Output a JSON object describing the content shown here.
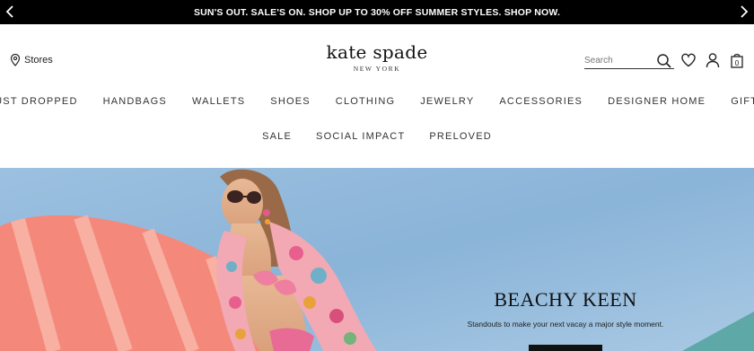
{
  "promo": {
    "text": "SUN'S OUT. SALE'S ON. SHOP UP TO 30% OFF SUMMER STYLES. SHOP NOW."
  },
  "header": {
    "stores_label": "Stores",
    "logo_main": "kate spade",
    "logo_sub": "NEW YORK",
    "search_placeholder": "Search",
    "icons": [
      "map-pin-icon",
      "search-icon",
      "heart-icon",
      "user-icon",
      "bag-icon"
    ],
    "bag_count": "0"
  },
  "nav": {
    "row1": [
      "JUST DROPPED",
      "HANDBAGS",
      "WALLETS",
      "SHOES",
      "CLOTHING",
      "JEWELRY",
      "ACCESSORIES",
      "DESIGNER HOME",
      "GIFTS"
    ],
    "row2": [
      "SALE",
      "SOCIAL IMPACT",
      "PRELOVED"
    ]
  },
  "hero": {
    "title": "BEACHY KEEN",
    "subtitle": "Standouts to make your next vacay a major style moment."
  },
  "colors": {
    "promo_bg": "#000000",
    "surfboard": "#f4897b",
    "sky": "#8fb8dc"
  }
}
